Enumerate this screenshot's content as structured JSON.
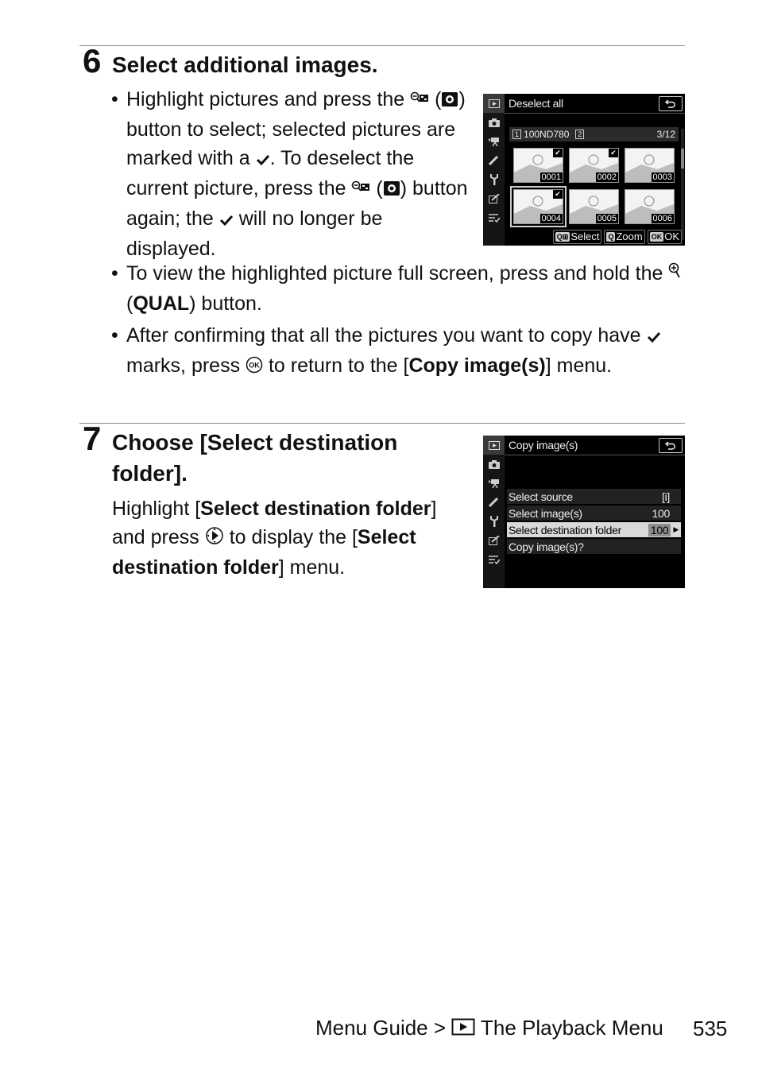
{
  "step6": {
    "number": "6",
    "title": "Select additional images.",
    "bullet1": {
      "p1": "Highlight pictures and press the ",
      "p2": " (",
      "p3": ") button to select; selected pictures are marked with a ",
      "p4": ". To deselect the current picture, press the ",
      "p5": " (",
      "p6": ") button again; the ",
      "p7": " will no longer be displayed."
    },
    "bullet2": {
      "p1": "To view the highlighted picture full screen, press and hold the ",
      "p2": " (",
      "bold": "QUAL",
      "p3": ") button."
    },
    "bullet3": {
      "p1": "After confirming that all the pictures you want to copy have ",
      "p2": " marks, press ",
      "p3": " to return to the [",
      "bold": "Copy image(s)",
      "p4": "] menu."
    }
  },
  "step7": {
    "number": "7",
    "title": "Choose [Select destination folder].",
    "para": {
      "p1": "Highlight [",
      "b1": "Select destination folder",
      "p2": "] and press ",
      "p3": " to display the [",
      "b2": "Select destination folder",
      "p4": "] menu."
    }
  },
  "screen1": {
    "title": "Deselect all",
    "card_label": "1",
    "folder": "100ND780",
    "card2_label": "2",
    "count": "3/12",
    "thumbnails": [
      {
        "num": "0001",
        "checked": true,
        "selected": false
      },
      {
        "num": "0002",
        "checked": true,
        "selected": false
      },
      {
        "num": "0003",
        "checked": false,
        "selected": false
      },
      {
        "num": "0004",
        "checked": true,
        "selected": true
      },
      {
        "num": "0005",
        "checked": false,
        "selected": false
      },
      {
        "num": "0006",
        "checked": false,
        "selected": false
      }
    ],
    "footer": {
      "select": "Select",
      "zoom": "Zoom",
      "ok_key": "OK",
      "ok": "OK"
    }
  },
  "screen2": {
    "title": "Copy image(s)",
    "items": [
      {
        "label": "Select source",
        "value": "[i]",
        "highlighted": false
      },
      {
        "label": "Select image(s)",
        "value": "100",
        "highlighted": false
      },
      {
        "label": "Select destination folder",
        "value": "100",
        "highlighted": true
      },
      {
        "label": "Copy image(s)?",
        "value": "",
        "highlighted": false
      }
    ]
  },
  "footer": {
    "section": "Menu Guide > ",
    "chapter": " The Playback Menu",
    "page": "535"
  }
}
